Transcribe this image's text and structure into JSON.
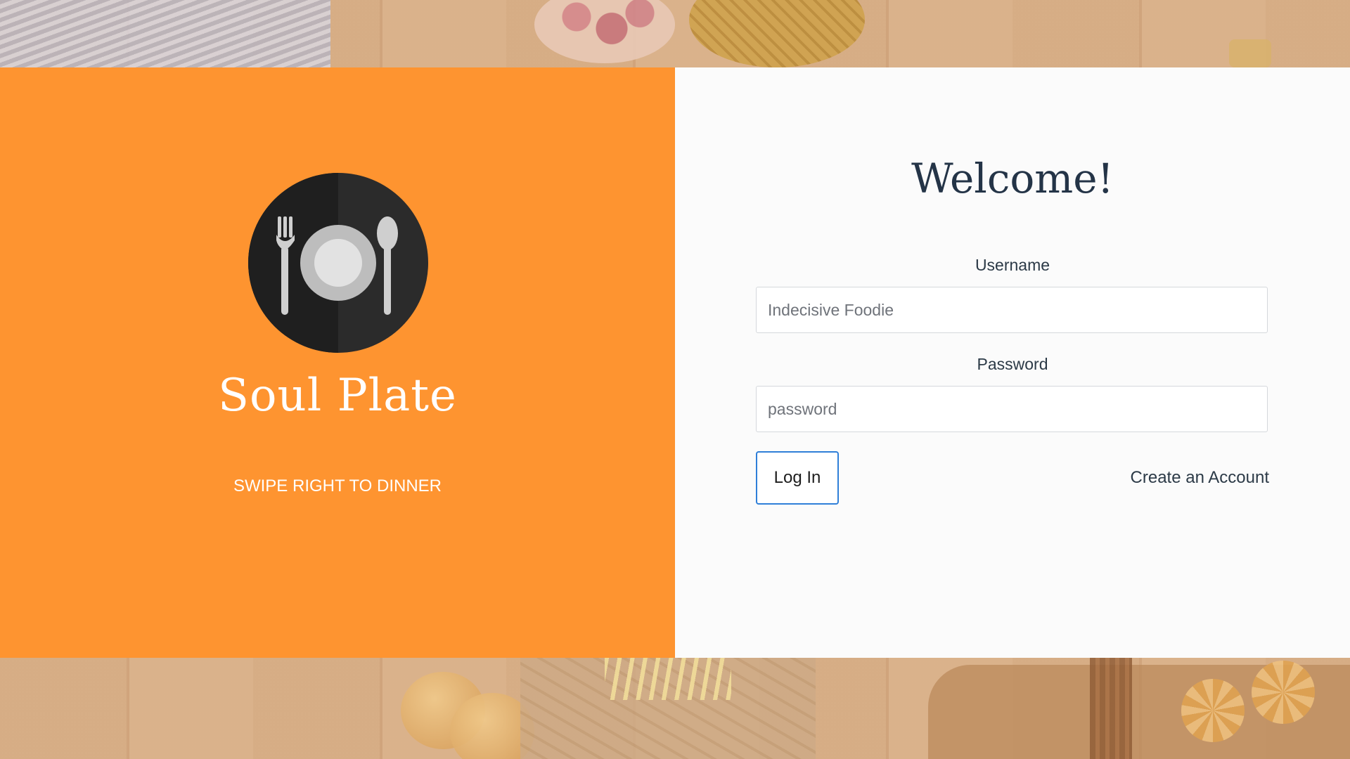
{
  "brand": {
    "title": "Soul Plate",
    "tagline": "SWIPE RIGHT TO DINNER",
    "logo_icon": "plate-fork-spoon-icon"
  },
  "form": {
    "heading": "Welcome!",
    "username_label": "Username",
    "username_placeholder": "Indecisive Foodie",
    "password_label": "Password",
    "password_placeholder": "password",
    "login_label": "Log In",
    "create_account_label": "Create an Account"
  },
  "colors": {
    "brand_orange": "#fe9430",
    "form_background": "#fbfbfb",
    "heading_text": "#243447",
    "button_border": "#2f7fd8"
  }
}
